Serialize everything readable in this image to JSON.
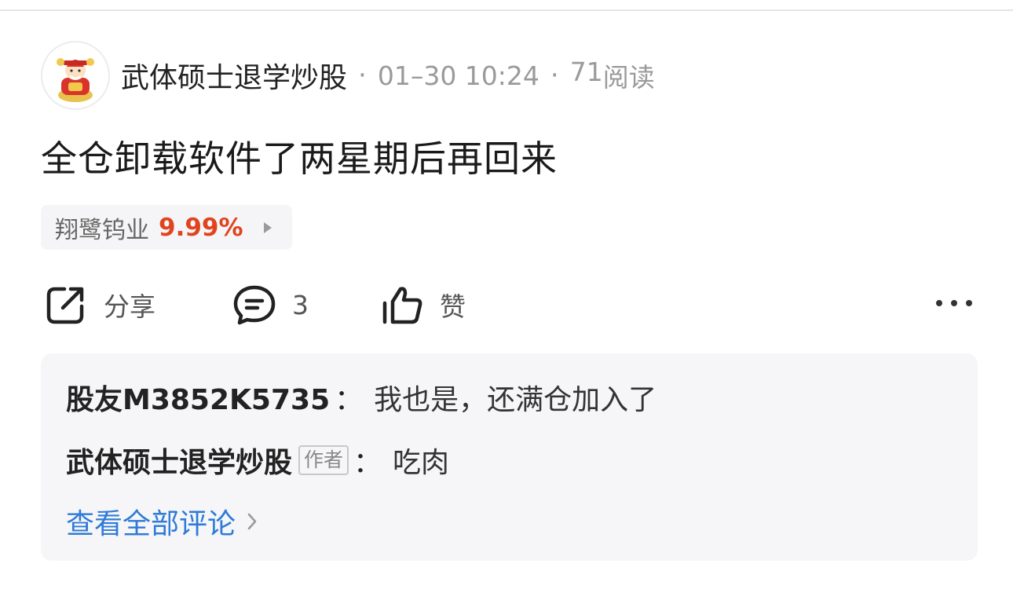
{
  "post": {
    "author": "武体硕士退学炒股",
    "date": "01–30 10:24",
    "reads_count": "71",
    "reads_label": "阅读",
    "separator": "·",
    "title": "全仓卸载软件了两星期后再回来"
  },
  "stock": {
    "name": "翔鹭钨业",
    "change": "9.99%",
    "change_color": "#e0441f"
  },
  "actions": {
    "share_label": "分享",
    "comment_count": "3",
    "like_label": "赞"
  },
  "comments": [
    {
      "user": "股友M3852K5735",
      "separator": "：",
      "text": "我也是，还满仓加入了"
    },
    {
      "user": "武体硕士退学炒股",
      "tag": "作者",
      "separator": "：",
      "text": "吃肉"
    }
  ],
  "view_all": {
    "label": "查看全部评论",
    "color": "#2f7bd8"
  },
  "icons": {
    "avatar": "fortune-god-avatar",
    "share": "share-icon",
    "comment": "comment-bubble-icon",
    "like": "thumbs-up-icon",
    "more": "more-dots-icon",
    "chip_arrow": "play-arrow-icon",
    "view_all_arrow": "chevron-right-icon"
  }
}
